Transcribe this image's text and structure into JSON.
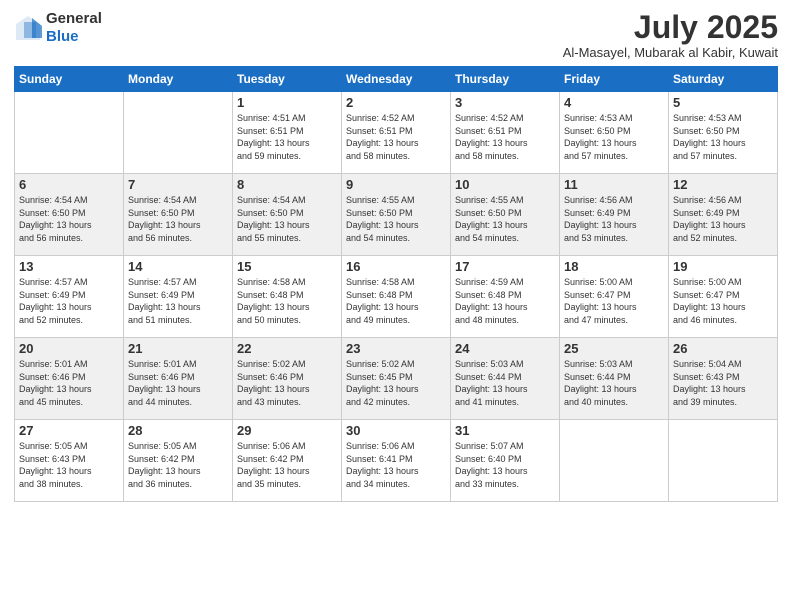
{
  "header": {
    "logo_general": "General",
    "logo_blue": "Blue",
    "title": "July 2025",
    "subtitle": "Al-Masayel, Mubarak al Kabir, Kuwait"
  },
  "days_of_week": [
    "Sunday",
    "Monday",
    "Tuesday",
    "Wednesday",
    "Thursday",
    "Friday",
    "Saturday"
  ],
  "weeks": [
    [
      {
        "day": "",
        "lines": []
      },
      {
        "day": "",
        "lines": []
      },
      {
        "day": "1",
        "lines": [
          "Sunrise: 4:51 AM",
          "Sunset: 6:51 PM",
          "Daylight: 13 hours",
          "and 59 minutes."
        ]
      },
      {
        "day": "2",
        "lines": [
          "Sunrise: 4:52 AM",
          "Sunset: 6:51 PM",
          "Daylight: 13 hours",
          "and 58 minutes."
        ]
      },
      {
        "day": "3",
        "lines": [
          "Sunrise: 4:52 AM",
          "Sunset: 6:51 PM",
          "Daylight: 13 hours",
          "and 58 minutes."
        ]
      },
      {
        "day": "4",
        "lines": [
          "Sunrise: 4:53 AM",
          "Sunset: 6:50 PM",
          "Daylight: 13 hours",
          "and 57 minutes."
        ]
      },
      {
        "day": "5",
        "lines": [
          "Sunrise: 4:53 AM",
          "Sunset: 6:50 PM",
          "Daylight: 13 hours",
          "and 57 minutes."
        ]
      }
    ],
    [
      {
        "day": "6",
        "lines": [
          "Sunrise: 4:54 AM",
          "Sunset: 6:50 PM",
          "Daylight: 13 hours",
          "and 56 minutes."
        ]
      },
      {
        "day": "7",
        "lines": [
          "Sunrise: 4:54 AM",
          "Sunset: 6:50 PM",
          "Daylight: 13 hours",
          "and 56 minutes."
        ]
      },
      {
        "day": "8",
        "lines": [
          "Sunrise: 4:54 AM",
          "Sunset: 6:50 PM",
          "Daylight: 13 hours",
          "and 55 minutes."
        ]
      },
      {
        "day": "9",
        "lines": [
          "Sunrise: 4:55 AM",
          "Sunset: 6:50 PM",
          "Daylight: 13 hours",
          "and 54 minutes."
        ]
      },
      {
        "day": "10",
        "lines": [
          "Sunrise: 4:55 AM",
          "Sunset: 6:50 PM",
          "Daylight: 13 hours",
          "and 54 minutes."
        ]
      },
      {
        "day": "11",
        "lines": [
          "Sunrise: 4:56 AM",
          "Sunset: 6:49 PM",
          "Daylight: 13 hours",
          "and 53 minutes."
        ]
      },
      {
        "day": "12",
        "lines": [
          "Sunrise: 4:56 AM",
          "Sunset: 6:49 PM",
          "Daylight: 13 hours",
          "and 52 minutes."
        ]
      }
    ],
    [
      {
        "day": "13",
        "lines": [
          "Sunrise: 4:57 AM",
          "Sunset: 6:49 PM",
          "Daylight: 13 hours",
          "and 52 minutes."
        ]
      },
      {
        "day": "14",
        "lines": [
          "Sunrise: 4:57 AM",
          "Sunset: 6:49 PM",
          "Daylight: 13 hours",
          "and 51 minutes."
        ]
      },
      {
        "day": "15",
        "lines": [
          "Sunrise: 4:58 AM",
          "Sunset: 6:48 PM",
          "Daylight: 13 hours",
          "and 50 minutes."
        ]
      },
      {
        "day": "16",
        "lines": [
          "Sunrise: 4:58 AM",
          "Sunset: 6:48 PM",
          "Daylight: 13 hours",
          "and 49 minutes."
        ]
      },
      {
        "day": "17",
        "lines": [
          "Sunrise: 4:59 AM",
          "Sunset: 6:48 PM",
          "Daylight: 13 hours",
          "and 48 minutes."
        ]
      },
      {
        "day": "18",
        "lines": [
          "Sunrise: 5:00 AM",
          "Sunset: 6:47 PM",
          "Daylight: 13 hours",
          "and 47 minutes."
        ]
      },
      {
        "day": "19",
        "lines": [
          "Sunrise: 5:00 AM",
          "Sunset: 6:47 PM",
          "Daylight: 13 hours",
          "and 46 minutes."
        ]
      }
    ],
    [
      {
        "day": "20",
        "lines": [
          "Sunrise: 5:01 AM",
          "Sunset: 6:46 PM",
          "Daylight: 13 hours",
          "and 45 minutes."
        ]
      },
      {
        "day": "21",
        "lines": [
          "Sunrise: 5:01 AM",
          "Sunset: 6:46 PM",
          "Daylight: 13 hours",
          "and 44 minutes."
        ]
      },
      {
        "day": "22",
        "lines": [
          "Sunrise: 5:02 AM",
          "Sunset: 6:46 PM",
          "Daylight: 13 hours",
          "and 43 minutes."
        ]
      },
      {
        "day": "23",
        "lines": [
          "Sunrise: 5:02 AM",
          "Sunset: 6:45 PM",
          "Daylight: 13 hours",
          "and 42 minutes."
        ]
      },
      {
        "day": "24",
        "lines": [
          "Sunrise: 5:03 AM",
          "Sunset: 6:44 PM",
          "Daylight: 13 hours",
          "and 41 minutes."
        ]
      },
      {
        "day": "25",
        "lines": [
          "Sunrise: 5:03 AM",
          "Sunset: 6:44 PM",
          "Daylight: 13 hours",
          "and 40 minutes."
        ]
      },
      {
        "day": "26",
        "lines": [
          "Sunrise: 5:04 AM",
          "Sunset: 6:43 PM",
          "Daylight: 13 hours",
          "and 39 minutes."
        ]
      }
    ],
    [
      {
        "day": "27",
        "lines": [
          "Sunrise: 5:05 AM",
          "Sunset: 6:43 PM",
          "Daylight: 13 hours",
          "and 38 minutes."
        ]
      },
      {
        "day": "28",
        "lines": [
          "Sunrise: 5:05 AM",
          "Sunset: 6:42 PM",
          "Daylight: 13 hours",
          "and 36 minutes."
        ]
      },
      {
        "day": "29",
        "lines": [
          "Sunrise: 5:06 AM",
          "Sunset: 6:42 PM",
          "Daylight: 13 hours",
          "and 35 minutes."
        ]
      },
      {
        "day": "30",
        "lines": [
          "Sunrise: 5:06 AM",
          "Sunset: 6:41 PM",
          "Daylight: 13 hours",
          "and 34 minutes."
        ]
      },
      {
        "day": "31",
        "lines": [
          "Sunrise: 5:07 AM",
          "Sunset: 6:40 PM",
          "Daylight: 13 hours",
          "and 33 minutes."
        ]
      },
      {
        "day": "",
        "lines": []
      },
      {
        "day": "",
        "lines": []
      }
    ]
  ]
}
